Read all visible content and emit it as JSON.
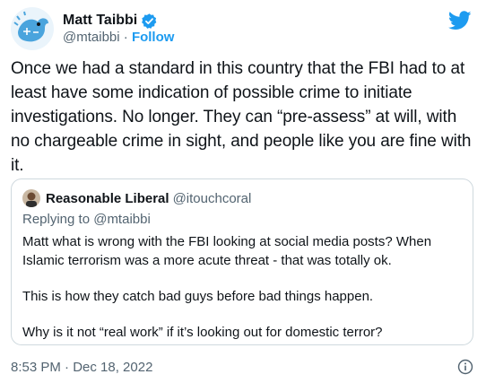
{
  "author": {
    "name": "Matt Taibbi",
    "handle": "@mtaibbi",
    "separator": " · ",
    "follow_label": "Follow"
  },
  "tweet": {
    "text": "Once we had a standard in this country that the FBI had to at least have some indication of possible crime to initiate investigations. No longer. They can “pre-assess” at will, with no chargeable crime in sight, and people like you are fine with it."
  },
  "quoted": {
    "name": "Reasonable Liberal",
    "handle": "@itouchcoral",
    "replying_to": "Replying to @mtaibbi",
    "paragraphs": [
      "Matt what is wrong with the FBI looking at social media posts? When Islamic terrorism was a more acute threat - that was totally ok.",
      "This is how they catch bad guys before bad things happen.",
      "Why is it not “real work” if it’s looking out for domestic terror?"
    ]
  },
  "timestamp": "8:53 PM · Dec 18, 2022",
  "icons": {
    "brand": "twitter-bird-icon",
    "verified": "verified-badge-icon",
    "info": "info-icon"
  },
  "colors": {
    "accent": "#1d9bf0",
    "text": "#0f1419",
    "secondary": "#536471",
    "border": "#cfd9de"
  }
}
